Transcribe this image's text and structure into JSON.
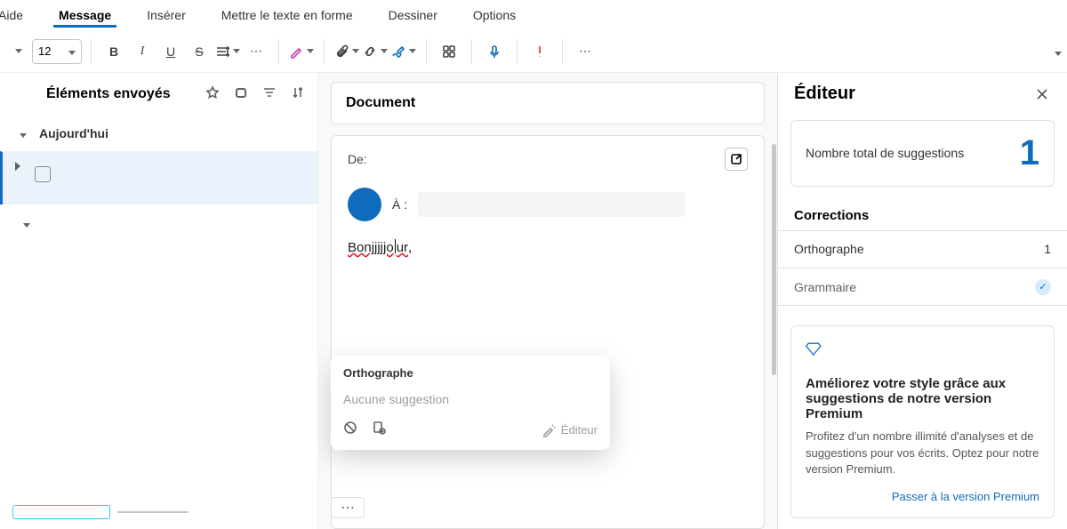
{
  "tabs": {
    "items": [
      "Aide",
      "Message",
      "Insérer",
      "Mettre le texte en forme",
      "Dessiner",
      "Options"
    ],
    "active_index": 1
  },
  "ribbon": {
    "font_size": "12"
  },
  "left": {
    "title": "Éléments envoyés",
    "group_today": "Aujourd'hui"
  },
  "center": {
    "doc_title": "Document",
    "from_label": "De:",
    "to_label": "À :",
    "body_text_pre": "Bonjjjjjo",
    "body_text_post": "ur",
    "body_text_suffix": ",",
    "popup": {
      "title": "Orthographe",
      "no_suggestion": "Aucune suggestion",
      "editor_label": "Éditeur"
    }
  },
  "editor": {
    "title": "Éditeur",
    "total_label": "Nombre total de suggestions",
    "total_count": "1",
    "sections": {
      "corrections_title": "Corrections",
      "spelling_label": "Orthographe",
      "spelling_count": "1",
      "grammar_label": "Grammaire"
    },
    "promo": {
      "headline": "Améliorez votre style grâce aux suggestions de notre version Premium",
      "body": "Profitez d'un nombre illimité d'analyses et de suggestions pour vos écrits. Optez pour notre version Premium.",
      "cta": "Passer à la version Premium"
    }
  }
}
